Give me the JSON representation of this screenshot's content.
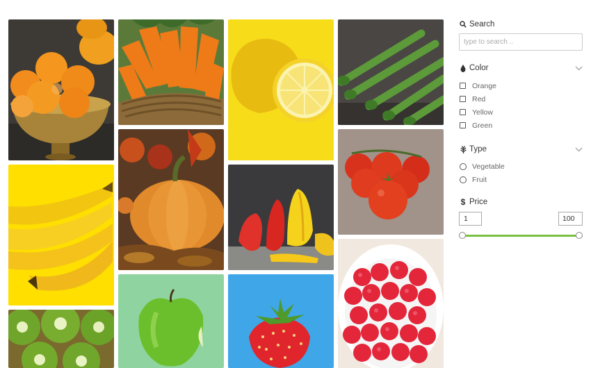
{
  "gallery": {
    "items": [
      {
        "name": "tangerines"
      },
      {
        "name": "carrots"
      },
      {
        "name": "lemon"
      },
      {
        "name": "asparagus"
      },
      {
        "name": "bananas"
      },
      {
        "name": "pumpkin"
      },
      {
        "name": "peppers"
      },
      {
        "name": "tomatoes"
      },
      {
        "name": "kiwi"
      },
      {
        "name": "green-apple"
      },
      {
        "name": "strawberry"
      },
      {
        "name": "raspberries"
      }
    ]
  },
  "search": {
    "title": "Search",
    "placeholder": "type to search ..",
    "value": "",
    "icon": "search-icon"
  },
  "color": {
    "title": "Color",
    "icon": "droplet-icon",
    "options": [
      {
        "label": "Orange",
        "checked": false
      },
      {
        "label": "Red",
        "checked": false
      },
      {
        "label": "Yellow",
        "checked": false
      },
      {
        "label": "Green",
        "checked": false
      }
    ]
  },
  "type": {
    "title": "Type",
    "icon": "leaf-icon",
    "options": [
      {
        "label": "Vegetable",
        "selected": false
      },
      {
        "label": "Fruit",
        "selected": false
      }
    ]
  },
  "price": {
    "title": "Price",
    "icon": "dollar-icon",
    "min": "1",
    "max": "100",
    "range_low_fraction": 0,
    "range_high_fraction": 1
  },
  "colors": {
    "accent": "#7ac142",
    "border": "#cccccc"
  }
}
